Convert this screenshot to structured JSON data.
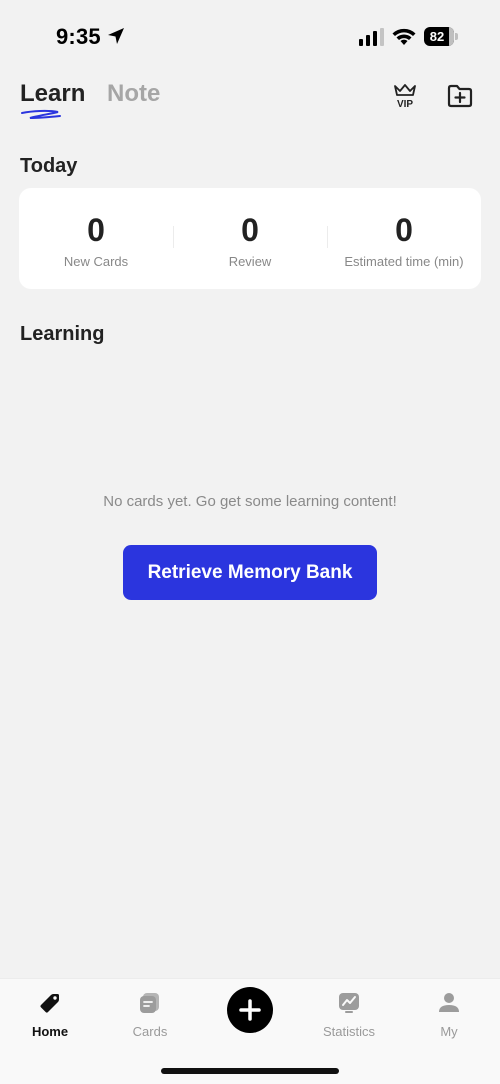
{
  "status_bar": {
    "time": "9:35",
    "battery_level": "82",
    "battery_fraction": 0.82
  },
  "header": {
    "tabs": [
      {
        "label": "Learn",
        "active": true
      },
      {
        "label": "Note",
        "active": false
      }
    ],
    "icons": [
      "vip-crown-icon",
      "folder-add-icon"
    ]
  },
  "today": {
    "title": "Today",
    "stats": [
      {
        "value": "0",
        "label": "New Cards"
      },
      {
        "value": "0",
        "label": "Review"
      },
      {
        "value": "0",
        "label": "Estimated time (min)"
      }
    ]
  },
  "learning": {
    "title": "Learning",
    "empty_message": "No cards yet. Go get some learning content!",
    "action_label": "Retrieve Memory Bank"
  },
  "bottom_nav": {
    "items": [
      {
        "label": "Home",
        "icon": "home-tag-icon",
        "active": true
      },
      {
        "label": "Cards",
        "icon": "cards-icon",
        "active": false
      },
      {
        "label": "",
        "icon": "add-icon",
        "active": false
      },
      {
        "label": "Statistics",
        "icon": "statistics-icon",
        "active": false
      },
      {
        "label": "My",
        "icon": "profile-icon",
        "active": false
      }
    ]
  },
  "colors": {
    "accent": "#2b35de",
    "background": "#f2f2f2",
    "card": "#ffffff",
    "muted_text": "#8a8a8a",
    "inactive_tab": "#a6a6a6"
  }
}
